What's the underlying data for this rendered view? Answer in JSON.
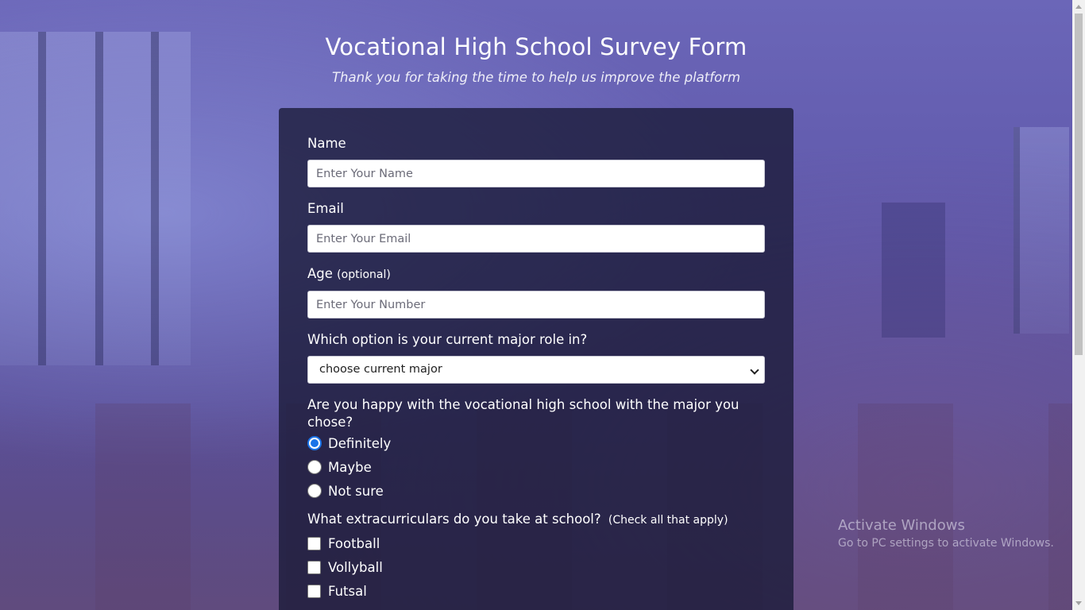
{
  "header": {
    "title": "Vocational High School Survey Form",
    "subtitle": "Thank you for taking the time to help us improve the platform"
  },
  "form": {
    "name": {
      "label": "Name",
      "placeholder": "Enter Your Name",
      "value": ""
    },
    "email": {
      "label": "Email",
      "placeholder": "Enter Your Email",
      "value": ""
    },
    "age": {
      "label": "Age",
      "label_note": "(optional)",
      "placeholder": "Enter Your Number",
      "value": ""
    },
    "major": {
      "label": "Which option is your current major role in?",
      "selected": "choose current major"
    },
    "happy": {
      "question": "Are you happy with the vocational high school with the major you chose?",
      "options": [
        "Definitely",
        "Maybe",
        "Not sure"
      ],
      "selected_index": 0
    },
    "extracurriculars": {
      "question": "What extracurriculars do you take at school?",
      "note": "(Check all that apply)",
      "options": [
        "Football",
        "Vollyball",
        "Futsal"
      ],
      "checked": [
        false,
        false,
        false
      ]
    }
  },
  "watermark": {
    "title": "Activate Windows",
    "subtitle": "Go to PC settings to activate Windows."
  },
  "colors": {
    "background": "#5f58aa",
    "card": "#1b1c3a",
    "radio_accent": "#1a73e8"
  }
}
